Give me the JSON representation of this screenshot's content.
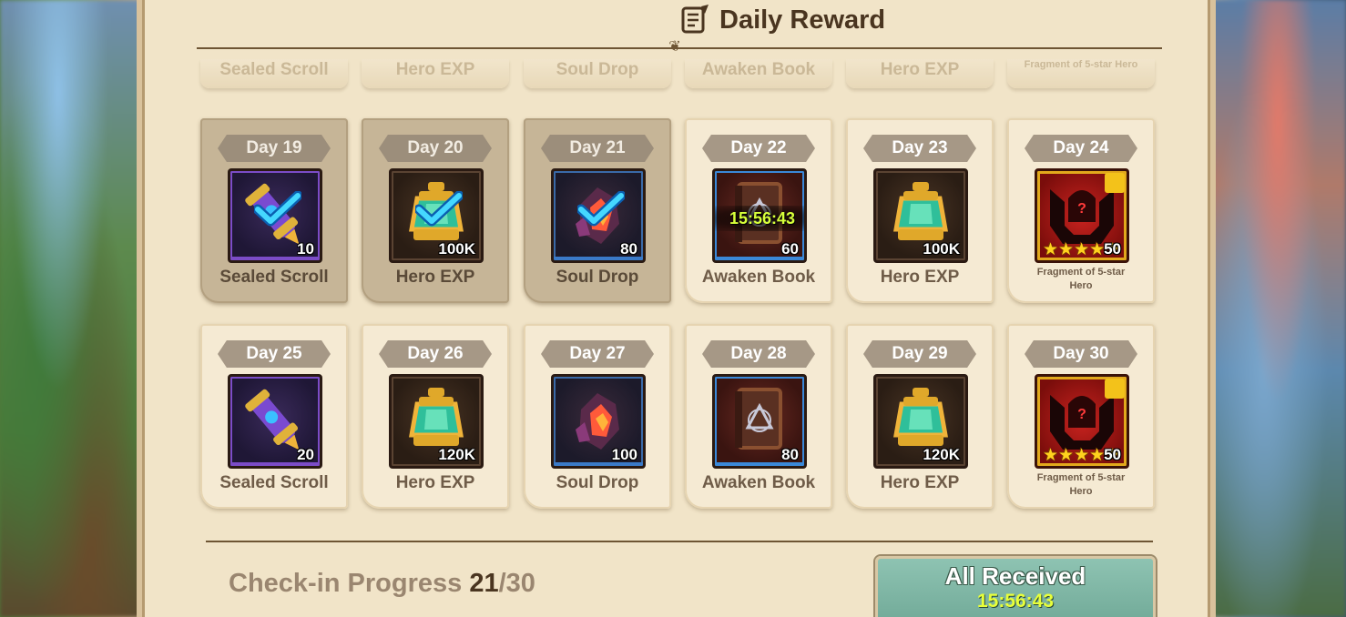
{
  "header": {
    "title": "Daily Reward",
    "title_icon": "scroll-quill-icon"
  },
  "previous_row": [
    {
      "name": "Sealed Scroll"
    },
    {
      "name": "Hero EXP"
    },
    {
      "name": "Soul Drop"
    },
    {
      "name": "Awaken Book"
    },
    {
      "name": "Hero EXP"
    },
    {
      "name": "Fragment of 5-star Hero"
    }
  ],
  "rows": [
    [
      {
        "day": "Day 19",
        "name": "Sealed Scroll",
        "qty": "10",
        "state": "claimed",
        "icon": "sealed-scroll-icon",
        "rarity": "purple"
      },
      {
        "day": "Day 20",
        "name": "Hero EXP",
        "qty": "100K",
        "state": "claimed",
        "icon": "hero-exp-lantern-icon",
        "rarity": "brown"
      },
      {
        "day": "Day 21",
        "name": "Soul Drop",
        "qty": "80",
        "state": "claimed",
        "icon": "soul-drop-crystal-icon",
        "rarity": "blue"
      },
      {
        "day": "Day 22",
        "name": "Awaken Book",
        "qty": "60",
        "state": "current",
        "timer": "15:56:43",
        "icon": "awaken-book-icon",
        "rarity": "red"
      },
      {
        "day": "Day 23",
        "name": "Hero EXP",
        "qty": "100K",
        "state": "future",
        "icon": "hero-exp-lantern-icon",
        "rarity": "brown"
      },
      {
        "day": "Day 24",
        "name": "Fragment of 5-star Hero",
        "qty": "50",
        "state": "future",
        "icon": "hero-fragment-icon",
        "rarity": "gold",
        "stars": 5
      }
    ],
    [
      {
        "day": "Day 25",
        "name": "Sealed Scroll",
        "qty": "20",
        "state": "future",
        "icon": "sealed-scroll-icon",
        "rarity": "purple"
      },
      {
        "day": "Day 26",
        "name": "Hero EXP",
        "qty": "120K",
        "state": "future",
        "icon": "hero-exp-lantern-icon",
        "rarity": "brown"
      },
      {
        "day": "Day 27",
        "name": "Soul Drop",
        "qty": "100",
        "state": "future",
        "icon": "soul-drop-crystal-icon",
        "rarity": "blue"
      },
      {
        "day": "Day 28",
        "name": "Awaken Book",
        "qty": "80",
        "state": "future",
        "icon": "awaken-book-icon",
        "rarity": "red"
      },
      {
        "day": "Day 29",
        "name": "Hero EXP",
        "qty": "120K",
        "state": "future",
        "icon": "hero-exp-lantern-icon",
        "rarity": "brown"
      },
      {
        "day": "Day 30",
        "name": "Fragment of 5-star Hero",
        "qty": "50",
        "state": "future",
        "icon": "hero-fragment-icon",
        "rarity": "gold",
        "stars": 5
      }
    ]
  ],
  "footer": {
    "progress_label": "Check-in Progress",
    "progress_current": "21",
    "progress_total": "/30",
    "button_label": "All Received",
    "button_timer": "15:56:43"
  },
  "colors": {
    "panel_bg": "#f1e4c8",
    "claimed_card": "#c6b597",
    "timer_green": "#d7ff3a",
    "button_teal": "#7fb6a4"
  }
}
